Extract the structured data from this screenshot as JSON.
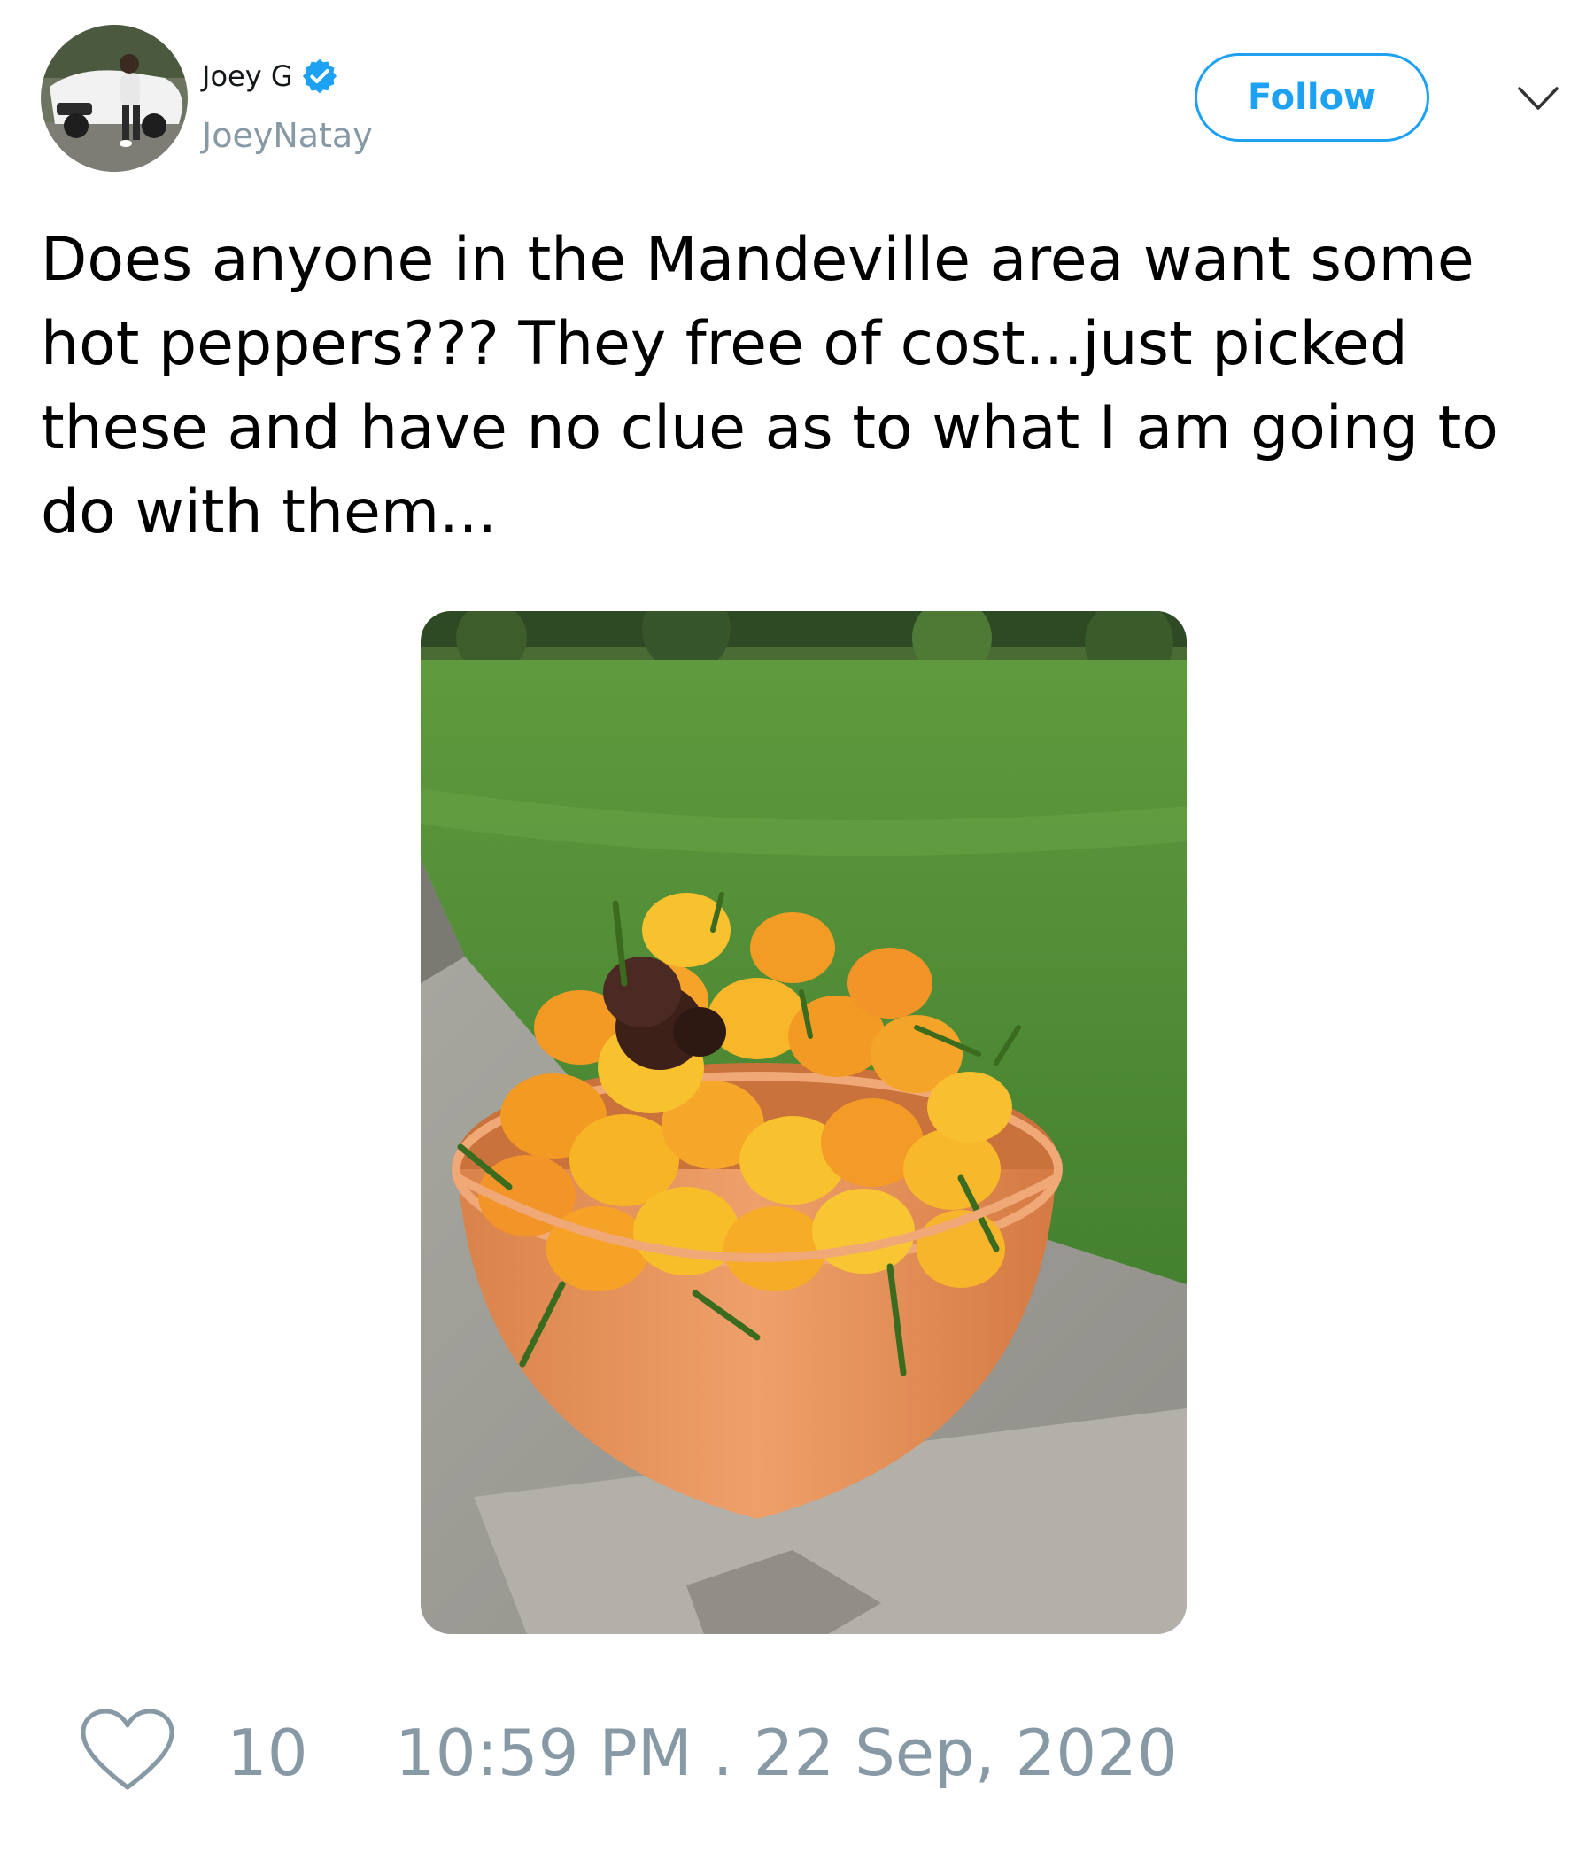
{
  "author": {
    "display_name": "Joey G",
    "handle": "JoeyNatay",
    "verified": true,
    "verified_icon": "verified-badge-icon",
    "avatar": "car-and-person-photo"
  },
  "actions": {
    "follow_label": "Follow",
    "menu_icon": "chevron-down-icon"
  },
  "tweet": {
    "text": "Does anyone in the Mandeville area want some hot peppers??? They free of cost...just picked these and have no clue as to what I am going to do with them...",
    "media": "photo-bowl-of-scotch-bonnet-peppers"
  },
  "footer": {
    "like_icon": "heart-icon",
    "like_count": "10",
    "timestamp": "10:59 PM . 22 Sep, 2020"
  },
  "colors": {
    "accent": "#1da1f2",
    "muted": "#8899a6",
    "text": "#000000"
  }
}
